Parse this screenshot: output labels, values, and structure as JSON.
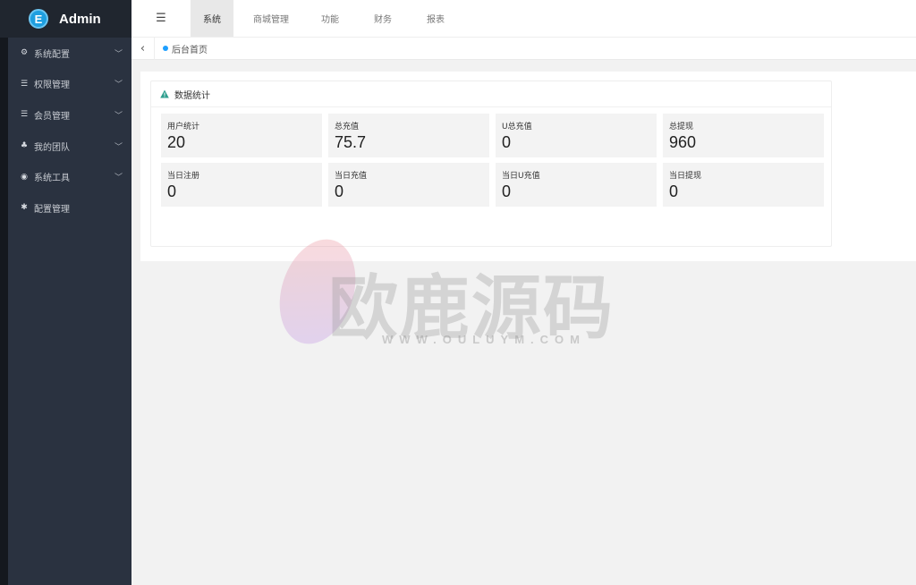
{
  "app": {
    "title": "Admin",
    "logo_letter": "E"
  },
  "sidebar": {
    "items": [
      {
        "label": "系统配置",
        "icon": "gears-icon",
        "glyph": "⚙",
        "has_children": true
      },
      {
        "label": "权限管理",
        "icon": "list-icon",
        "glyph": "☰",
        "has_children": true
      },
      {
        "label": "会员管理",
        "icon": "list-icon",
        "glyph": "☰",
        "has_children": true
      },
      {
        "label": "我的团队",
        "icon": "sitemap-icon",
        "glyph": "♣",
        "has_children": true
      },
      {
        "label": "系统工具",
        "icon": "disc-icon",
        "glyph": "◉",
        "has_children": true
      },
      {
        "label": "配置管理",
        "icon": "asterisk-icon",
        "glyph": "✱",
        "has_children": false
      }
    ]
  },
  "topbar": {
    "toggle_glyph": "☰",
    "tabs": [
      {
        "label": "系统",
        "active": true
      },
      {
        "label": "商城管理",
        "active": false
      },
      {
        "label": "功能",
        "active": false
      },
      {
        "label": "财务",
        "active": false
      },
      {
        "label": "报表",
        "active": false
      }
    ]
  },
  "breadcrumb": {
    "back_glyph": "‹",
    "current": "后台首页"
  },
  "card": {
    "title": "数据统计",
    "stats": [
      {
        "label": "用户统计",
        "value": "20"
      },
      {
        "label": "总充值",
        "value": "75.7"
      },
      {
        "label": "U总充值",
        "value": "0"
      },
      {
        "label": "总提现",
        "value": "960"
      },
      {
        "label": "当日注册",
        "value": "0"
      },
      {
        "label": "当日充值",
        "value": "0"
      },
      {
        "label": "当日U充值",
        "value": "0"
      },
      {
        "label": "当日提现",
        "value": "0"
      }
    ]
  },
  "watermark": {
    "text": "欧鹿源码",
    "sub": "WWW.OULUYM.COM"
  },
  "colors": {
    "sidebar": "#2a3240",
    "accent": "#1e9fff",
    "warning": "#2e9e8e"
  }
}
